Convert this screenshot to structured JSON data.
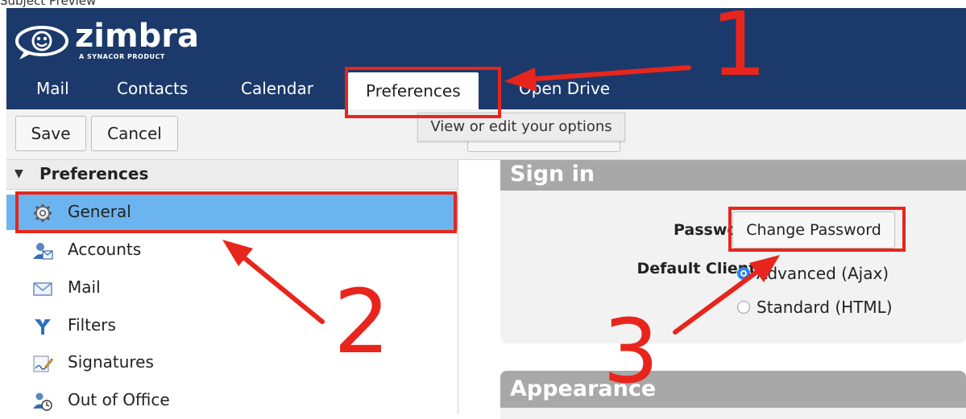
{
  "app": {
    "brand": "zimbra",
    "brand_sub": "A SYNACOR PRODUCT",
    "top_strip_text": "Subject Preview"
  },
  "tabs": [
    {
      "label": "Mail"
    },
    {
      "label": "Contacts"
    },
    {
      "label": "Calendar"
    },
    {
      "label": "Preferences",
      "active": true
    },
    {
      "label": "Open Drive"
    }
  ],
  "toolbar": {
    "save_label": "Save",
    "cancel_label": "Cancel"
  },
  "tooltip": {
    "text": "View or edit your options"
  },
  "sidebar": {
    "title": "Preferences",
    "items": [
      {
        "label": "General",
        "icon": "gear-icon",
        "selected": true
      },
      {
        "label": "Accounts",
        "icon": "accounts-icon"
      },
      {
        "label": "Mail",
        "icon": "envelope-icon"
      },
      {
        "label": "Filters",
        "icon": "filter-icon"
      },
      {
        "label": "Signatures",
        "icon": "signature-icon"
      },
      {
        "label": "Out of Office",
        "icon": "out-of-office-icon"
      }
    ]
  },
  "signin": {
    "header": "Sign in",
    "password_label": "Password:",
    "change_password_label": "Change Password",
    "default_client_label": "Default Client:",
    "options": [
      {
        "label": "Advanced (Ajax)",
        "checked": true
      },
      {
        "label": "Standard (HTML)",
        "checked": false
      }
    ]
  },
  "appearance": {
    "header": "Appearance"
  },
  "annotations": {
    "numbers": [
      "1",
      "2",
      "3"
    ],
    "color": "#e8251c"
  },
  "colors": {
    "header_bg": "#1b3a6b",
    "selection": "#6cb4ef",
    "card_header": "#a8a8a8"
  }
}
